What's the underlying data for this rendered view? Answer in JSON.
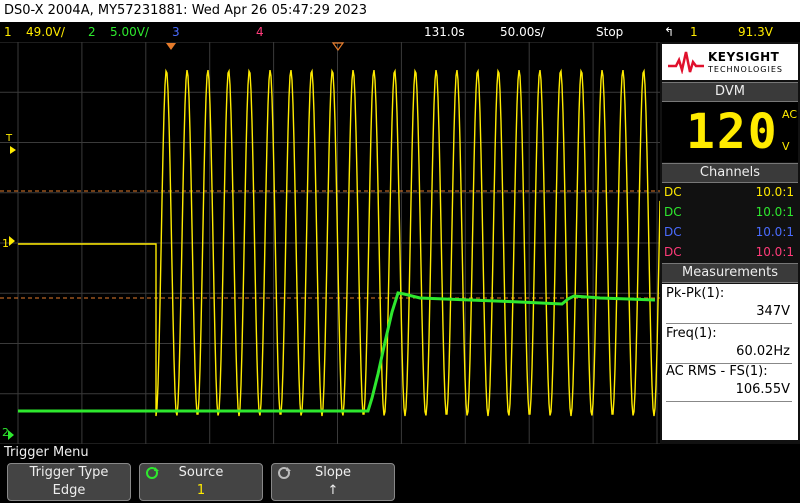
{
  "titlebar": {
    "text": "DS0-X 2004A, MY57231881: Wed Apr 26 05:47:29 2023"
  },
  "status": {
    "ch1_num": "1",
    "ch1_scale": "49.0V/",
    "ch2_num": "2",
    "ch2_scale": "5.00V/",
    "ch3_num": "3",
    "ch4_num": "4",
    "delay": "131.0s",
    "timebase": "50.00s/",
    "run_state": "Stop",
    "trig_slope_icon": "rising-edge-icon",
    "trig_source": "1",
    "trig_level": "91.3V"
  },
  "colors": {
    "ch1": "#ffeb00",
    "ch2": "#2ee82e",
    "ch3": "#4a6cff",
    "ch4": "#ff3b7a",
    "accent": "#e57b2b"
  },
  "panel": {
    "brand": "KEYSIGHT",
    "brand_sub": "TECHNOLOGIES",
    "dvm_title": "DVM",
    "dvm_value": "120",
    "dvm_mode": "AC",
    "dvm_unit": "V",
    "channels_title": "Channels",
    "channels": [
      {
        "coupling": "DC",
        "ratio": "10.0:1"
      },
      {
        "coupling": "DC",
        "ratio": "10.0:1"
      },
      {
        "coupling": "DC",
        "ratio": "10.0:1"
      },
      {
        "coupling": "DC",
        "ratio": "10.0:1"
      }
    ],
    "measurements_title": "Measurements",
    "measurements": [
      {
        "label": "Pk-Pk(1):",
        "value": "347V"
      },
      {
        "label": "Freq(1):",
        "value": "60.02Hz"
      },
      {
        "label": "AC RMS - FS(1):",
        "value": "106.55V"
      }
    ]
  },
  "markers": {
    "trigger": "T",
    "ch1": "1",
    "ch2": "2"
  },
  "menu": {
    "title": "Trigger Menu",
    "softkeys": [
      {
        "label": "Trigger Type",
        "value": "Edge"
      },
      {
        "label": "Source",
        "value": "1"
      },
      {
        "label": "Slope",
        "value": "↑"
      }
    ]
  }
}
